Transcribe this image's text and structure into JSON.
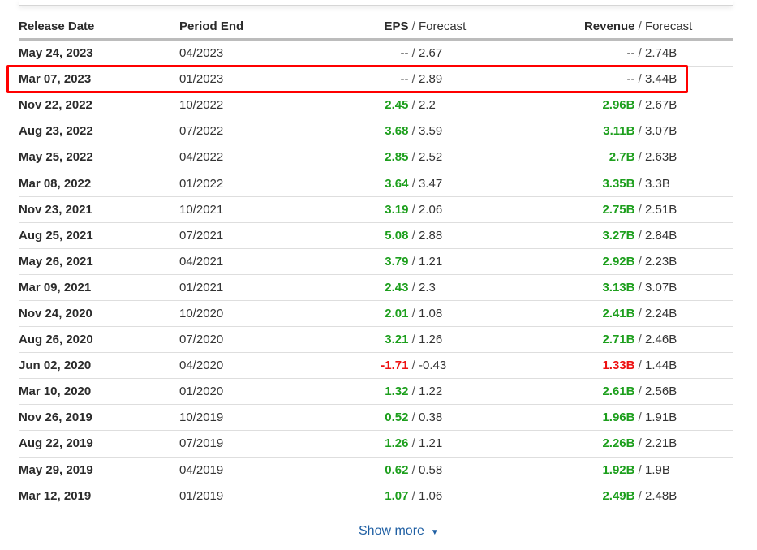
{
  "table": {
    "headers": {
      "release_date": "Release Date",
      "period_end": "Period End",
      "eps": "EPS",
      "eps_forecast": "Forecast",
      "revenue": "Revenue",
      "revenue_forecast": "Forecast",
      "separator": " / "
    },
    "rows": [
      {
        "release_date": "May 24, 2023",
        "period_end": "04/2023",
        "eps": "--",
        "eps_status": "na",
        "eps_forecast": "2.67",
        "revenue": "--",
        "revenue_status": "na",
        "revenue_forecast": "2.74B"
      },
      {
        "release_date": "Mar 07, 2023",
        "period_end": "01/2023",
        "eps": "--",
        "eps_status": "na",
        "eps_forecast": "2.89",
        "revenue": "--",
        "revenue_status": "na",
        "revenue_forecast": "3.44B",
        "highlighted": true
      },
      {
        "release_date": "Nov 22, 2022",
        "period_end": "10/2022",
        "eps": "2.45",
        "eps_status": "beat",
        "eps_forecast": "2.2",
        "revenue": "2.96B",
        "revenue_status": "beat",
        "revenue_forecast": "2.67B"
      },
      {
        "release_date": "Aug 23, 2022",
        "period_end": "07/2022",
        "eps": "3.68",
        "eps_status": "beat",
        "eps_forecast": "3.59",
        "revenue": "3.11B",
        "revenue_status": "beat",
        "revenue_forecast": "3.07B"
      },
      {
        "release_date": "May 25, 2022",
        "period_end": "04/2022",
        "eps": "2.85",
        "eps_status": "beat",
        "eps_forecast": "2.52",
        "revenue": "2.7B",
        "revenue_status": "beat",
        "revenue_forecast": "2.63B"
      },
      {
        "release_date": "Mar 08, 2022",
        "period_end": "01/2022",
        "eps": "3.64",
        "eps_status": "beat",
        "eps_forecast": "3.47",
        "revenue": "3.35B",
        "revenue_status": "beat",
        "revenue_forecast": "3.3B"
      },
      {
        "release_date": "Nov 23, 2021",
        "period_end": "10/2021",
        "eps": "3.19",
        "eps_status": "beat",
        "eps_forecast": "2.06",
        "revenue": "2.75B",
        "revenue_status": "beat",
        "revenue_forecast": "2.51B"
      },
      {
        "release_date": "Aug 25, 2021",
        "period_end": "07/2021",
        "eps": "5.08",
        "eps_status": "beat",
        "eps_forecast": "2.88",
        "revenue": "3.27B",
        "revenue_status": "beat",
        "revenue_forecast": "2.84B"
      },
      {
        "release_date": "May 26, 2021",
        "period_end": "04/2021",
        "eps": "3.79",
        "eps_status": "beat",
        "eps_forecast": "1.21",
        "revenue": "2.92B",
        "revenue_status": "beat",
        "revenue_forecast": "2.23B"
      },
      {
        "release_date": "Mar 09, 2021",
        "period_end": "01/2021",
        "eps": "2.43",
        "eps_status": "beat",
        "eps_forecast": "2.3",
        "revenue": "3.13B",
        "revenue_status": "beat",
        "revenue_forecast": "3.07B"
      },
      {
        "release_date": "Nov 24, 2020",
        "period_end": "10/2020",
        "eps": "2.01",
        "eps_status": "beat",
        "eps_forecast": "1.08",
        "revenue": "2.41B",
        "revenue_status": "beat",
        "revenue_forecast": "2.24B"
      },
      {
        "release_date": "Aug 26, 2020",
        "period_end": "07/2020",
        "eps": "3.21",
        "eps_status": "beat",
        "eps_forecast": "1.26",
        "revenue": "2.71B",
        "revenue_status": "beat",
        "revenue_forecast": "2.46B"
      },
      {
        "release_date": "Jun 02, 2020",
        "period_end": "04/2020",
        "eps": "-1.71",
        "eps_status": "miss",
        "eps_forecast": "-0.43",
        "revenue": "1.33B",
        "revenue_status": "miss",
        "revenue_forecast": "1.44B"
      },
      {
        "release_date": "Mar 10, 2020",
        "period_end": "01/2020",
        "eps": "1.32",
        "eps_status": "beat",
        "eps_forecast": "1.22",
        "revenue": "2.61B",
        "revenue_status": "beat",
        "revenue_forecast": "2.56B"
      },
      {
        "release_date": "Nov 26, 2019",
        "period_end": "10/2019",
        "eps": "0.52",
        "eps_status": "beat",
        "eps_forecast": "0.38",
        "revenue": "1.96B",
        "revenue_status": "beat",
        "revenue_forecast": "1.91B"
      },
      {
        "release_date": "Aug 22, 2019",
        "period_end": "07/2019",
        "eps": "1.26",
        "eps_status": "beat",
        "eps_forecast": "1.21",
        "revenue": "2.26B",
        "revenue_status": "beat",
        "revenue_forecast": "2.21B"
      },
      {
        "release_date": "May 29, 2019",
        "period_end": "04/2019",
        "eps": "0.62",
        "eps_status": "beat",
        "eps_forecast": "0.58",
        "revenue": "1.92B",
        "revenue_status": "beat",
        "revenue_forecast": "1.9B"
      },
      {
        "release_date": "Mar 12, 2019",
        "period_end": "01/2019",
        "eps": "1.07",
        "eps_status": "beat",
        "eps_forecast": "1.06",
        "revenue": "2.49B",
        "revenue_status": "beat",
        "revenue_forecast": "2.48B"
      }
    ]
  },
  "footer": {
    "show_more_label": "Show more",
    "show_more_icon": "chevron-down-icon"
  },
  "colors": {
    "beat": "#1d9f1d",
    "miss": "#ee1111",
    "highlight_border": "#ff0000",
    "link": "#1f5fa3"
  }
}
